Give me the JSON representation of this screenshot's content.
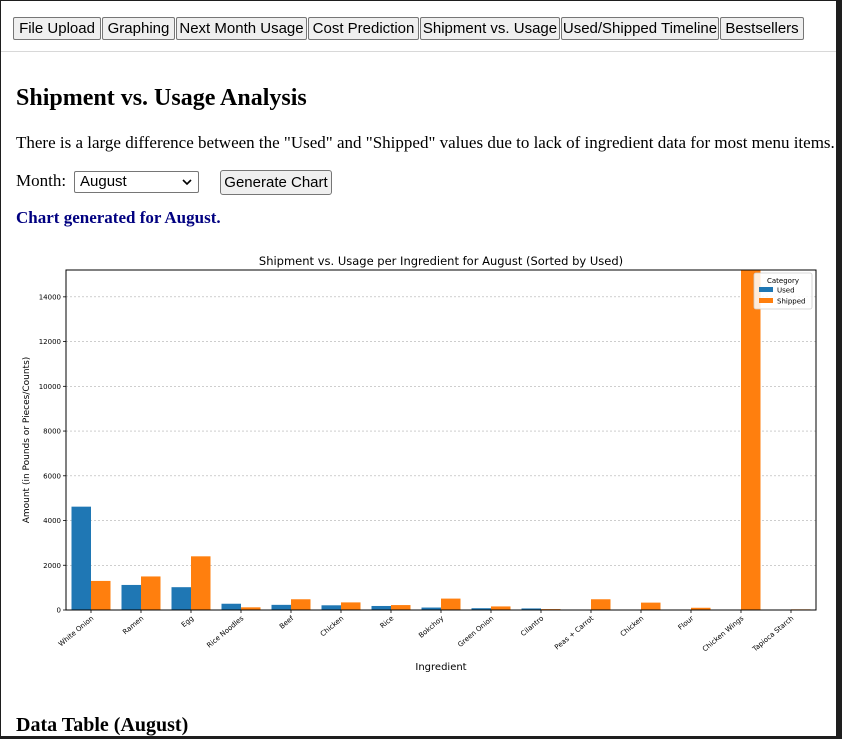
{
  "nav": {
    "tabs": [
      {
        "label": "File Upload"
      },
      {
        "label": "Graphing"
      },
      {
        "label": "Next Month Usage"
      },
      {
        "label": "Cost Prediction"
      },
      {
        "label": "Shipment vs. Usage"
      },
      {
        "label": "Used/Shipped Timeline"
      },
      {
        "label": "Bestsellers"
      }
    ]
  },
  "page": {
    "title": "Shipment vs. Usage Analysis",
    "note": "There is a large difference between the \"Used\" and \"Shipped\" values due to lack of ingredient data for most menu items.",
    "month_label": "Month:",
    "month_value": "August",
    "generate_label": "Generate Chart",
    "status": "Chart generated for August.",
    "table_heading": "Data Table (August)"
  },
  "colors": {
    "used": "#1f77b4",
    "shipped": "#ff7f0e"
  },
  "chart_data": {
    "type": "bar",
    "title": "Shipment vs. Usage per Ingredient for August (Sorted by Used)",
    "xlabel": "Ingredient",
    "ylabel": "Amount (in Pounds or Pieces/Counts)",
    "ylim": [
      0,
      15200
    ],
    "yticks": [
      0,
      2000,
      4000,
      6000,
      8000,
      10000,
      12000,
      14000
    ],
    "grid": "y",
    "legend": {
      "title": "Category",
      "position": "top-right"
    },
    "categories": [
      "White Onion",
      "Ramen",
      "Egg",
      "Rice Noodles",
      "Beef",
      "Chicken",
      "Rice",
      "Bokchoy",
      "Green Onion",
      "Cilantro",
      "Peas + Carrot",
      "Chicken",
      "Flour",
      "Chicken Wings",
      "Tapioca Starch"
    ],
    "series": [
      {
        "name": "Used",
        "values": [
          4620,
          1120,
          1020,
          280,
          230,
          210,
          180,
          110,
          80,
          70,
          0,
          0,
          0,
          0,
          0
        ]
      },
      {
        "name": "Shipped",
        "values": [
          1300,
          1500,
          2400,
          120,
          480,
          340,
          220,
          510,
          160,
          40,
          480,
          330,
          100,
          15200,
          30
        ]
      }
    ]
  }
}
